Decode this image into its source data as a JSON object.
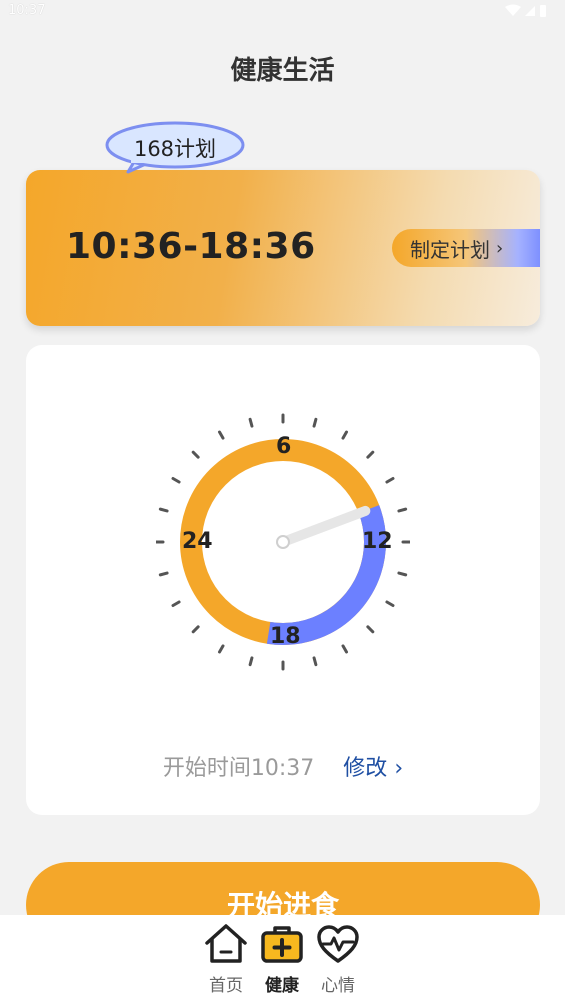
{
  "status_bar": {
    "time": "10:37"
  },
  "header": {
    "title": "健康生活"
  },
  "plan": {
    "badge_label": "168计划",
    "time_range": "10:36-18:36",
    "make_plan_label": "制定计划",
    "chevron": "›"
  },
  "clock": {
    "labels": {
      "top": "6",
      "right": "12",
      "bottom": "18",
      "left": "24"
    },
    "hours_per_revolution": 24,
    "eating_window_start_hour": 10.6,
    "eating_window_end_hour": 18.6,
    "current_hour": 10.62,
    "colors": {
      "fasting": "#f4a72a",
      "eating": "#6c80ff",
      "hand": "#e6e6e6",
      "ticks": "#555555"
    }
  },
  "start": {
    "label": "开始时间",
    "time": "10:37",
    "modify_label": "修改",
    "chevron": "›"
  },
  "action": {
    "start_eating_label": "开始进食"
  },
  "nav": {
    "items": [
      {
        "label": "首页",
        "icon": "home-icon"
      },
      {
        "label": "健康",
        "icon": "medical-kit-icon"
      },
      {
        "label": "心情",
        "icon": "heart-pulse-icon"
      }
    ],
    "active_index": 1
  }
}
